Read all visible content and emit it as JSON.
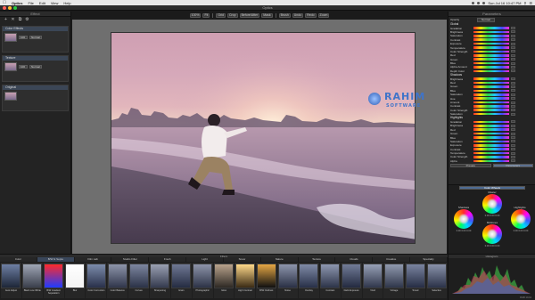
{
  "menubar": {
    "app_name": "Optics",
    "items": [
      "File",
      "Edit",
      "View",
      "Help"
    ],
    "clock": "Sun Jul 16  10:47 PM"
  },
  "window": {
    "title": "Optics"
  },
  "left_panel": {
    "title": "Effect",
    "layers": [
      {
        "name": "Color Effects",
        "blend_mode": "Normal",
        "opacity": "100"
      },
      {
        "name": "Texture",
        "blend_mode": "Normal",
        "opacity": "100"
      },
      {
        "name": "Original"
      }
    ]
  },
  "toolbar": {
    "buttons": [
      "100%",
      "Fit",
      "Grid",
      "Crop",
      "Before/After",
      "Mask",
      "Brush",
      "Undo",
      "Redo",
      "Zoom"
    ]
  },
  "parameters": {
    "title": "Parameters",
    "opacity_label": "Opacity",
    "mode_label": "Normal",
    "sections": [
      {
        "title": "Global",
        "rows": [
          "Gradation",
          "Brightness",
          "Saturation",
          "Contrast",
          "Exposure",
          "Temperature",
          "Color Strength",
          "Red",
          "Green",
          "Blue",
          "Alpha Amount",
          "Depth Color"
        ]
      },
      {
        "title": "Shadows",
        "rows": [
          "Brightness",
          "Red",
          "Green",
          "Blue",
          "Saturation",
          "Hue",
          "Amount",
          "Contrast",
          "Color Strength",
          "Saturation"
        ]
      },
      {
        "title": "Highlights",
        "rows": [
          "Gradation",
          "Brightness",
          "Red",
          "Green",
          "Blue",
          "Saturation",
          "Exposure",
          "Contrast",
          "Temperature",
          "Color Strength",
          "Alpha"
        ]
      }
    ],
    "presets": [
      "Presets",
      "Parameters"
    ]
  },
  "color_wheels": {
    "tab_labels": [
      "Color Wheels"
    ],
    "wheels": [
      {
        "name": "Master",
        "values": "0.00  0.00  0.00"
      },
      {
        "name": "Shadows",
        "values": "0.00  0.00  0.00"
      },
      {
        "name": "Highlights",
        "values": "0.00  0.00  0.00"
      },
      {
        "name": "Midtones",
        "values": "0.00  0.00  0.00"
      }
    ]
  },
  "watermark": {
    "line1": "RAHIM",
    "line2": "SOFTWARE"
  },
  "filters": {
    "title": "Filters",
    "categories": [
      "Color",
      "B/W & Sepia",
      "Film Lab",
      "Studio Filter",
      "Fresh",
      "Light",
      "Snow",
      "Nature",
      "Texture",
      "Clouds",
      "Creative",
      "Specialty"
    ],
    "items": [
      {
        "name": "Auto Adjust",
        "colors": [
          "#6e7fa3",
          "#1d2638"
        ]
      },
      {
        "name": "Black Low White",
        "colors": [
          "#9fa6b5",
          "#3a3f4c"
        ]
      },
      {
        "name": "B/W Gradient Separation",
        "colors": [
          "#ff2a2a",
          "#1f3bff"
        ]
      },
      {
        "name": "Blur",
        "colors": [
          "#ffffff",
          "#f3f3f3"
        ]
      },
      {
        "name": "Color Correction",
        "colors": [
          "#7c8cab",
          "#29304a"
        ]
      },
      {
        "name": "Color Balance",
        "colors": [
          "#8e95aa",
          "#30364b"
        ]
      },
      {
        "name": "Curves",
        "colors": [
          "#7d86a0",
          "#2b3247"
        ]
      },
      {
        "name": "Sharpening",
        "colors": [
          "#9aa0b2",
          "#343a4e"
        ]
      },
      {
        "name": "Grain",
        "colors": [
          "#6f7893",
          "#252c42"
        ]
      },
      {
        "name": "Photographic",
        "colors": [
          "#8d94a9",
          "#2d3347"
        ]
      },
      {
        "name": "Glow",
        "colors": [
          "#b9a38c",
          "#2e2924"
        ]
      },
      {
        "name": "High Contrast",
        "colors": [
          "#ffd98a",
          "#3a2a14"
        ]
      },
      {
        "name": "B/W Outlines",
        "colors": [
          "#e6a744",
          "#101010"
        ]
      },
      {
        "name": "Noise",
        "colors": [
          "#8d95ab",
          "#2a3045"
        ]
      },
      {
        "name": "Overlay",
        "colors": [
          "#7f8aa6",
          "#283048"
        ]
      },
      {
        "name": "Contrast",
        "colors": [
          "#8e97b0",
          "#2d3449"
        ]
      },
      {
        "name": "Dark Exposure",
        "colors": [
          "#727c97",
          "#232a40"
        ]
      },
      {
        "name": "Vivid",
        "colors": [
          "#97a0b6",
          "#30374c"
        ]
      },
      {
        "name": "Vintage",
        "colors": [
          "#9099ae",
          "#2f364a"
        ]
      },
      {
        "name": "Toned",
        "colors": [
          "#7a84a0",
          "#262d44"
        ]
      },
      {
        "name": "Selective",
        "colors": [
          "#8992aa",
          "#2b3248"
        ]
      }
    ]
  },
  "histogram": {
    "title": "Histogram",
    "footer": "RGB  10-bit"
  },
  "colors": {
    "accent": "#4d6b93",
    "window_bg": "#1b1b1b",
    "canvas_bg": "#6f6f6f"
  }
}
